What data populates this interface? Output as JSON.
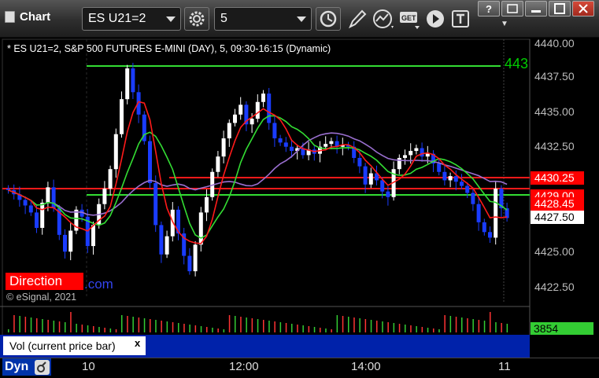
{
  "toolbar": {
    "app_title": "Chart",
    "symbol": "ES U21=2",
    "interval": "5",
    "icons": [
      "symbol-settings-icon",
      "interval-clock-icon",
      "drawing-pen-icon",
      "studies-icon",
      "get-data-icon",
      "play-icon",
      "text-tool-icon"
    ]
  },
  "window": {
    "help_label": "?",
    "restore_label": "",
    "minimize_label": "",
    "maximize_label": "",
    "close_label": ""
  },
  "legend": {
    "text": "* ES U21=2, S&P 500 FUTURES E-MINI (DAY), 5, 09:30-16:15 (Dynamic)"
  },
  "overlay": {
    "direction_label": "Direction",
    "url_fragment": ".com",
    "copyright": "© eSignal, 2021",
    "right_line_label": "443"
  },
  "price_axis": {
    "ticks": [
      "4440.00",
      "4437.50",
      "4435.00",
      "4432.50",
      "4427.50",
      "4425.00",
      "4422.50"
    ],
    "labels": [
      {
        "text": "4430.25",
        "bg": "#ff0000",
        "fg": "#ffffff"
      },
      {
        "text": "4429.00",
        "bg": "#ff0000",
        "fg": "#ffffff"
      },
      {
        "text": "4428.45",
        "bg": "#ff0000",
        "fg": "#ffffff"
      },
      {
        "text": "4427.50",
        "bg": "#ffffff",
        "fg": "#000000"
      }
    ]
  },
  "volume": {
    "current_value": "3854",
    "study_label": "Vol (current price bar)",
    "close_label": "x"
  },
  "time_axis": {
    "labels": [
      "10",
      "12:00",
      "14:00",
      "11"
    ],
    "dyn_label": "Dyn"
  },
  "colors": {
    "up_candle": "#ffffff",
    "down_candle": "#1a3cff",
    "ma_fast": "#ff1a1a",
    "ma_slow": "#33dd33",
    "ma_mid": "#9a6fd0",
    "horizontal_green": "#33dd33",
    "horizontal_red": "#ff1a1a"
  }
}
